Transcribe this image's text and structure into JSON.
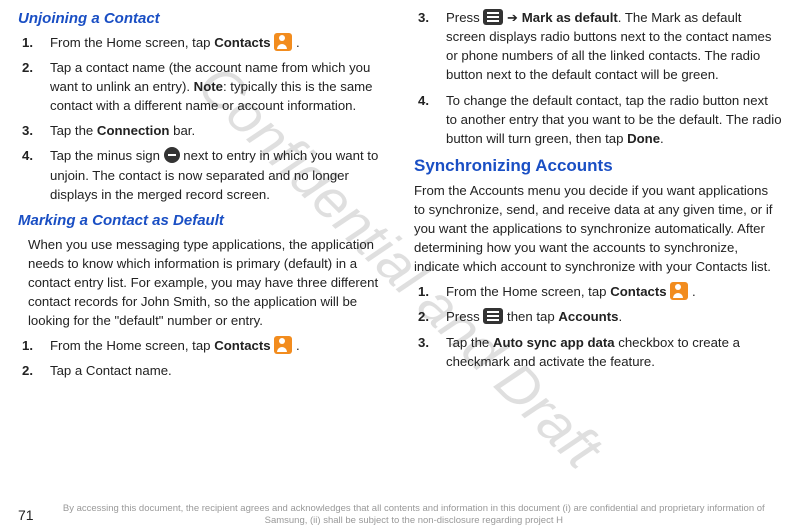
{
  "watermark": "Confidential and Draft",
  "left": {
    "sub1": "Unjoining a Contact",
    "steps1": [
      {
        "pre": "From the Home screen, tap ",
        "bold": "Contacts",
        "icon": "contacts",
        "post": " ."
      },
      {
        "pre": "Tap a contact name (the account name from which you want to unlink an entry). ",
        "bold": "Note",
        "post": ": typically this is the same contact with a different name or account information."
      },
      {
        "pre": "Tap the ",
        "bold": "Connection",
        "post": " bar."
      },
      {
        "pre": "Tap the minus sign ",
        "icon": "minus",
        "post": " next to entry in which you want to unjoin. The contact is now separated and no longer displays in the merged record screen."
      }
    ],
    "sub2": "Marking a Contact as Default",
    "para": "When you use messaging type applications, the application needs to know which information is primary (default) in a contact entry list. For example, you may have three different contact records for John Smith, so the application will be looking for the \"default\" number or entry.",
    "steps2": [
      {
        "pre": "From the Home screen, tap ",
        "bold": "Contacts",
        "icon": "contacts",
        "post": " ."
      },
      {
        "pre": "Tap a Contact name."
      }
    ]
  },
  "right": {
    "steps3": [
      {
        "num": "3.",
        "pre": "Press ",
        "icon": "menu",
        "mid": " ➔ ",
        "bold": "Mark as default",
        "post": ". The Mark as default screen displays radio buttons next to the contact names or phone numbers of all the linked contacts. The radio button next to the default contact will be green."
      },
      {
        "num": "4.",
        "pre": "To change the default contact, tap the radio button next to another entry that you want to be the default. The radio button will turn green, then tap ",
        "bold": "Done",
        "post": "."
      }
    ],
    "heading": "Synchronizing Accounts",
    "para": "From the Accounts menu you decide if you want applications to synchronize, send, and receive data at any given time, or if you want the applications to synchronize automatically. After determining how you want the accounts to synchronize, indicate which account to synchronize with your Contacts list.",
    "steps4": [
      {
        "pre": "From the Home screen, tap ",
        "bold": "Contacts",
        "icon": "contacts",
        "post": " ."
      },
      {
        "pre": "Press ",
        "icon": "menu",
        "mid": " then tap ",
        "bold": "Accounts",
        "post": "."
      },
      {
        "pre": "Tap the ",
        "bold": "Auto sync app data",
        "post": " checkbox to create a checkmark and activate the feature."
      }
    ]
  },
  "footer": {
    "page": "71",
    "text": "By accessing this document, the recipient agrees and acknowledges that all contents and information in this document (i) are confidential and proprietary information of Samsung, (ii) shall be subject to the non-disclosure regarding project H "
  }
}
